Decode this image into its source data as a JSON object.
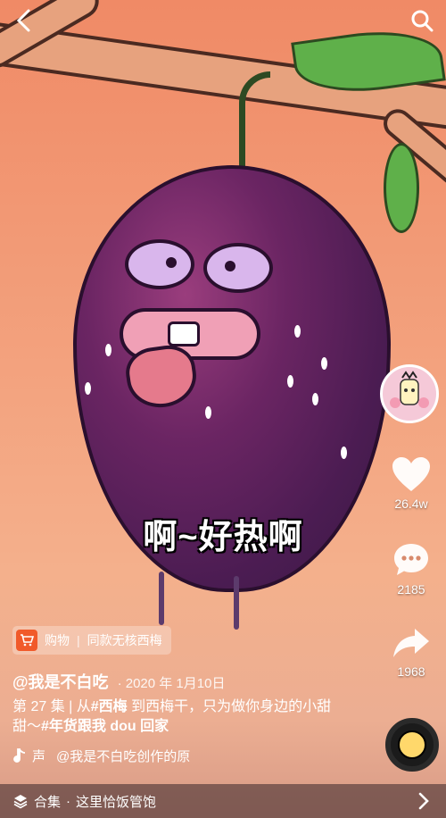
{
  "caption": "啊~好热啊",
  "shop": {
    "label": "购物",
    "product": "同款无核西梅"
  },
  "author": {
    "handle": "@我是不白吃",
    "date": "· 2020 年 1月10日"
  },
  "description": {
    "part1": "第 27 集 | 从",
    "tag1": "#西梅",
    "part2": " 到西梅干，只为做你身边的小甜甜～",
    "tag2": "#年货跟我 dou 回家"
  },
  "music": {
    "tag": "声",
    "text": "@我是不白吃创作的原"
  },
  "rail": {
    "likes": "26.4w",
    "comments": "2185",
    "shares": "1968"
  },
  "collection": {
    "label": "合集",
    "dot": "·",
    "title": "这里恰饭管饱"
  },
  "icons": {
    "back": "chevron-left-icon",
    "search": "search-icon",
    "like": "heart-icon",
    "comment": "comment-icon",
    "share": "share-icon",
    "collection": "layers-icon"
  }
}
